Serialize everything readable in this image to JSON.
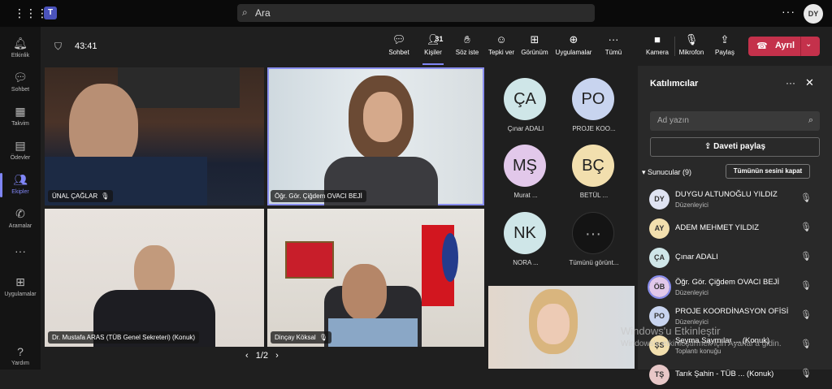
{
  "topbar": {
    "search_placeholder": "Ara",
    "avatar_initials": "DY"
  },
  "rail": [
    {
      "label": "Etkinlik",
      "icon": "bell-icon"
    },
    {
      "label": "Sohbet",
      "icon": "chat-icon"
    },
    {
      "label": "Takvim",
      "icon": "calendar-icon"
    },
    {
      "label": "Ödevler",
      "icon": "assignments-icon"
    },
    {
      "label": "Ekipler",
      "icon": "teams-icon"
    },
    {
      "label": "Aramalar",
      "icon": "phone-icon"
    },
    {
      "label": "Uygulamalar",
      "icon": "apps-icon"
    },
    {
      "label": "Yardım",
      "icon": "help-icon"
    }
  ],
  "meeting": {
    "timer": "43:41",
    "tools": {
      "chat": "Sohbet",
      "people": "Kişiler",
      "people_count": "31",
      "raise": "Söz iste",
      "react": "Tepki ver",
      "view": "Görünüm",
      "apps": "Uygulamalar",
      "more": "Tümü",
      "camera": "Kamera",
      "mic": "Mikrofon",
      "share": "Paylaş",
      "leave": "Ayrıl"
    }
  },
  "videos": [
    {
      "name": "ÜNAL ÇAĞLAR"
    },
    {
      "name": "Öğr. Gör. Çiğdem OVACI BEJİ"
    },
    {
      "name": "Dr. Mustafa ARAS (TÜB Genel Sekreteri) (Konuk)"
    },
    {
      "name": "Dinçay Köksal"
    }
  ],
  "participant_tiles": [
    {
      "initials": "ÇA",
      "name": "Çınar ADALI",
      "color": "#cfe6e8"
    },
    {
      "initials": "PO",
      "name": "PROJE KOO...",
      "color": "#c8d4ef"
    },
    {
      "initials": "MŞ",
      "name": "Murat ...",
      "color": "#e2c8ea"
    },
    {
      "initials": "BÇ",
      "name": "BETÜL ...",
      "color": "#f2dfae"
    },
    {
      "initials": "NK",
      "name": "NORA ...",
      "color": "#cfe6e8"
    },
    {
      "initials": "···",
      "name": "Tümünü görünt...",
      "color": "#141414"
    }
  ],
  "pager": "1/2",
  "panel": {
    "title": "Katılımcılar",
    "search_placeholder": "Ad yazın",
    "share_label": "Daveti paylaş",
    "section": "Sunucular (9)",
    "mute_all": "Tümünün sesini kapat",
    "people": [
      {
        "initials": "DY",
        "name": "DUYGU ALTUNOĞLU YILDIZ",
        "role": "Düzenleyici",
        "color": "#dfe3f2"
      },
      {
        "initials": "AY",
        "name": "ADEM MEHMET YILDIZ",
        "role": "",
        "color": "#f2dfae"
      },
      {
        "initials": "ÇA",
        "name": "Çınar ADALI",
        "role": "",
        "color": "#cfe6e8"
      },
      {
        "initials": "ÖB",
        "name": "Öğr. Gör. Çiğdem OVACI BEJİ",
        "role": "Düzenleyici",
        "color": "#e2c8ea"
      },
      {
        "initials": "PO",
        "name": "PROJE KOORDİNASYON OFİSİ",
        "role": "Düzenleyici",
        "color": "#c8d4ef"
      },
      {
        "initials": "ŞS",
        "name": "Şeyma Saymılar ... (Konuk)",
        "role": "Toplantı konuğu",
        "color": "#f2dfae"
      },
      {
        "initials": "TŞ",
        "name": "Tarık Şahin - TÜB ... (Konuk)",
        "role": "",
        "color": "#e8c8c8"
      }
    ]
  },
  "watermark": {
    "line1": "Windows'u Etkinleştir",
    "line2": "Windows'u etkinleştirmek için Ayarlar'a gidin."
  }
}
